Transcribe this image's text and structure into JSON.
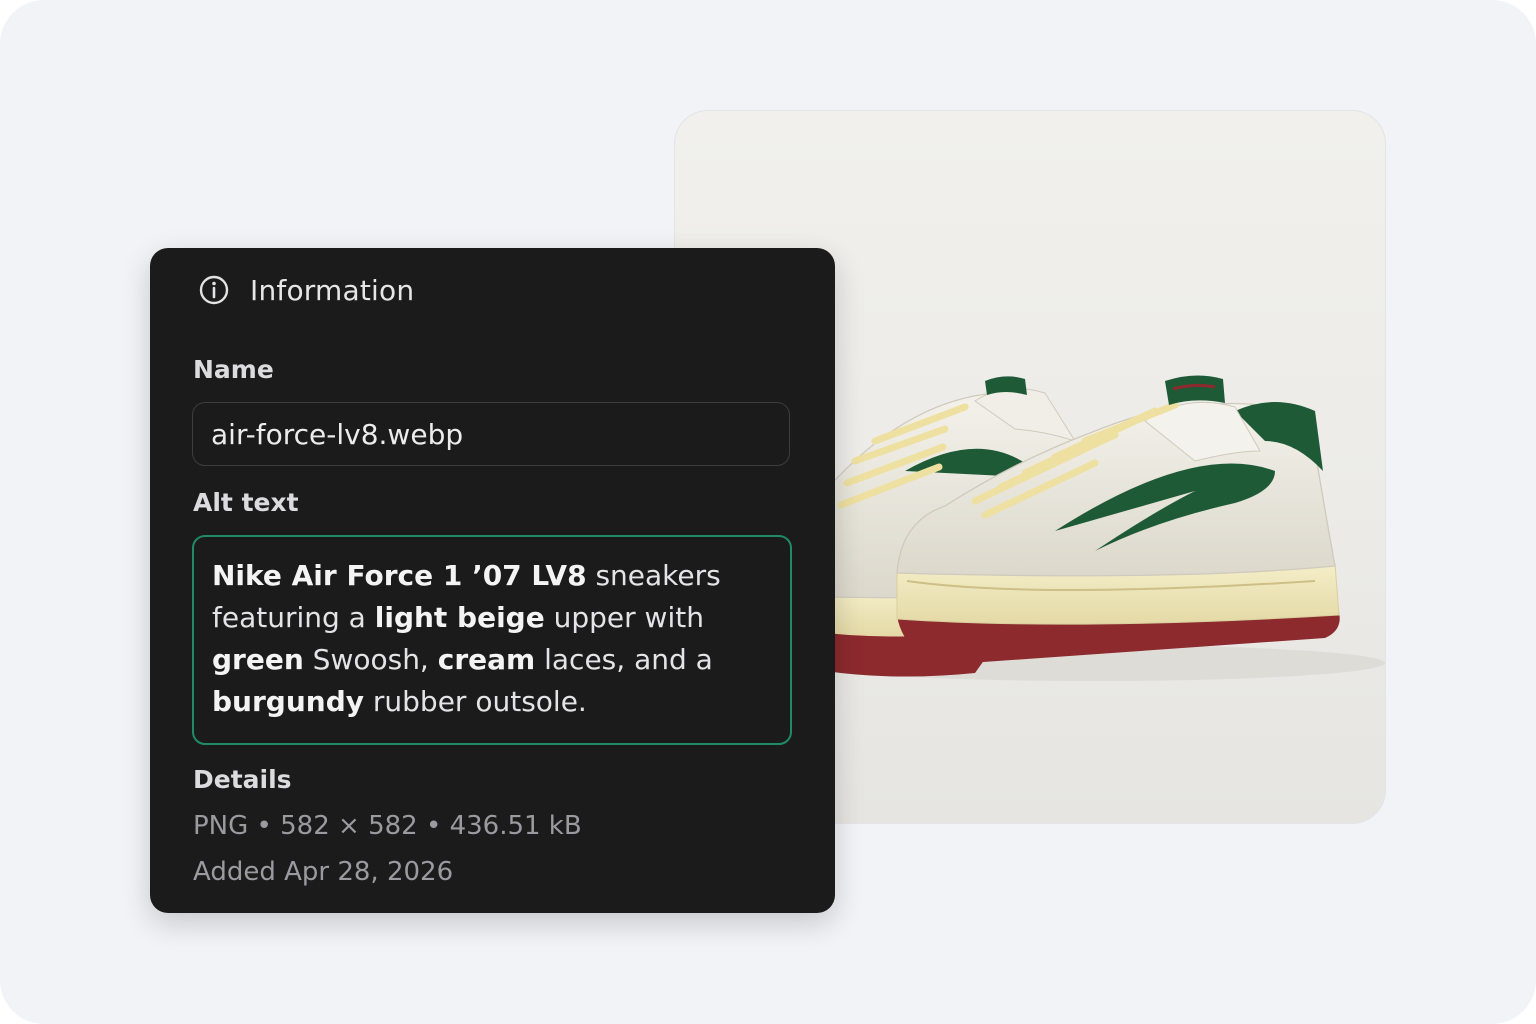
{
  "panel": {
    "title": "Information",
    "title_icon": "info-circle-icon",
    "name_label": "Name",
    "name_value": "air-force-lv8.webp",
    "alt_label": "Alt text",
    "alt_text": {
      "segments": [
        {
          "text": "Nike Air Force 1 ’07 LV8",
          "bold": true
        },
        {
          "text": " sneakers featuring a ",
          "bold": false
        },
        {
          "text": "light beige",
          "bold": true
        },
        {
          "text": " upper with ",
          "bold": false
        },
        {
          "text": "green",
          "bold": true
        },
        {
          "text": " Swoosh, ",
          "bold": false
        },
        {
          "text": "cream",
          "bold": true
        },
        {
          "text": " laces, and a ",
          "bold": false
        },
        {
          "text": "burgundy",
          "bold": true
        },
        {
          "text": " rubber outsole.",
          "bold": false
        }
      ]
    },
    "details_label": "Details",
    "details_meta": "PNG • 582 × 582 • 436.51 kB",
    "details_added": "Added Apr 28, 2026"
  },
  "image_preview": {
    "subject": "sneaker-pair-image"
  },
  "colors": {
    "panel_bg": "#1b1b1c",
    "page_bg": "#f2f3f6",
    "focus_border": "#1f8a63",
    "shoe_green": "#1f5a36",
    "shoe_burgundy": "#8c2a2e",
    "shoe_cream": "#eee6c2"
  }
}
